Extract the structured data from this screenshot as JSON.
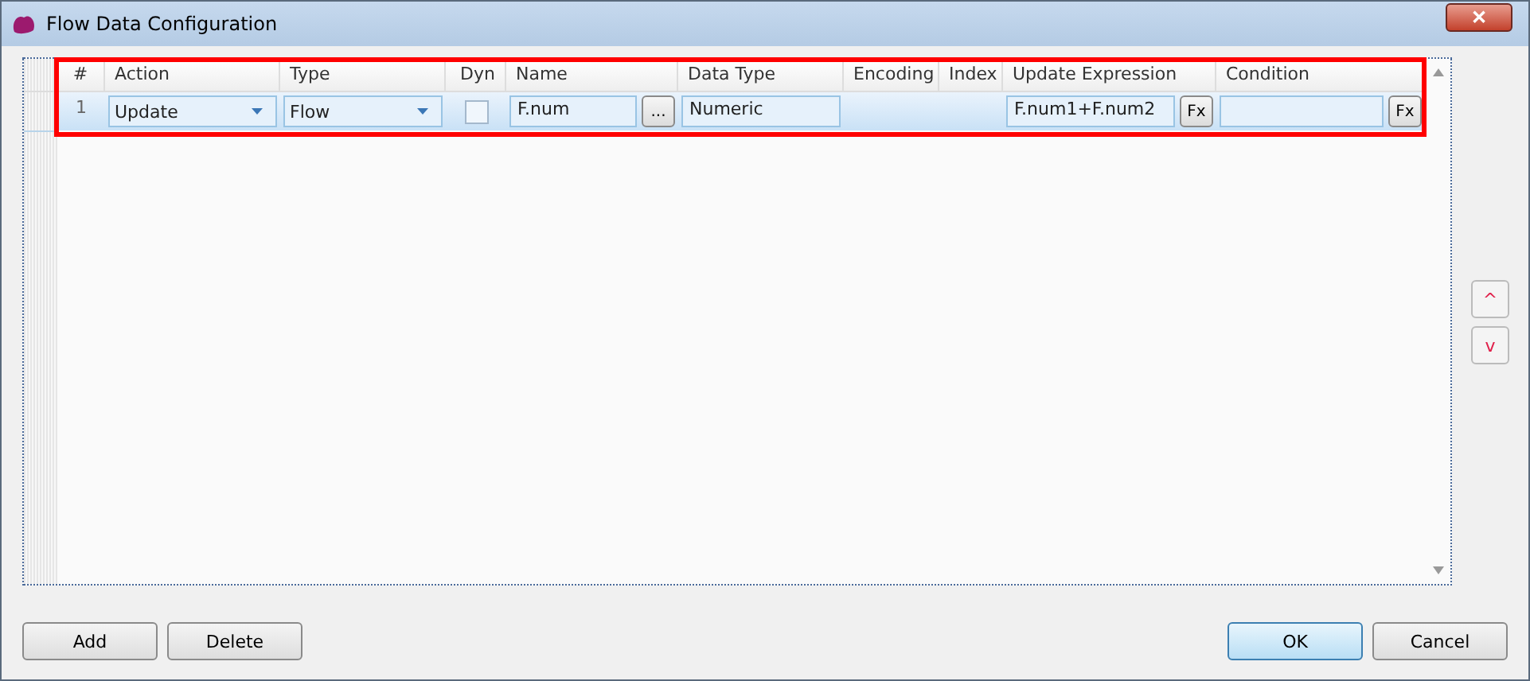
{
  "window": {
    "title": "Flow Data Configuration",
    "close": "✕"
  },
  "table": {
    "highlighted": true,
    "columns": [
      "#",
      "Action",
      "Type",
      "Dyn",
      "Name",
      "Data Type",
      "Encoding",
      "Index",
      "Update Expression",
      "Condition"
    ],
    "rows": [
      {
        "selected": true,
        "cells": [
          {
            "kind": "number",
            "text": "1"
          },
          {
            "kind": "dropdown",
            "value": "Update"
          },
          {
            "kind": "dropdown",
            "value": "Flow"
          },
          {
            "kind": "checkbox",
            "checked": false
          },
          {
            "kind": "field-button",
            "value": "F.num",
            "button": "..."
          },
          {
            "kind": "field",
            "value": "Numeric"
          },
          {
            "kind": "empty"
          },
          {
            "kind": "empty"
          },
          {
            "kind": "field-button",
            "value": "F.num1+F.num2",
            "button": "Fx"
          },
          {
            "kind": "field-button",
            "button": "Fx"
          }
        ]
      }
    ]
  },
  "side_buttons": [
    "^",
    "v"
  ],
  "left_buttons": [
    {
      "label": "Add",
      "default": false
    },
    {
      "label": "Delete",
      "default": false
    }
  ],
  "right_buttons": [
    {
      "label": "OK",
      "default": true
    },
    {
      "label": "Cancel",
      "default": false
    }
  ]
}
